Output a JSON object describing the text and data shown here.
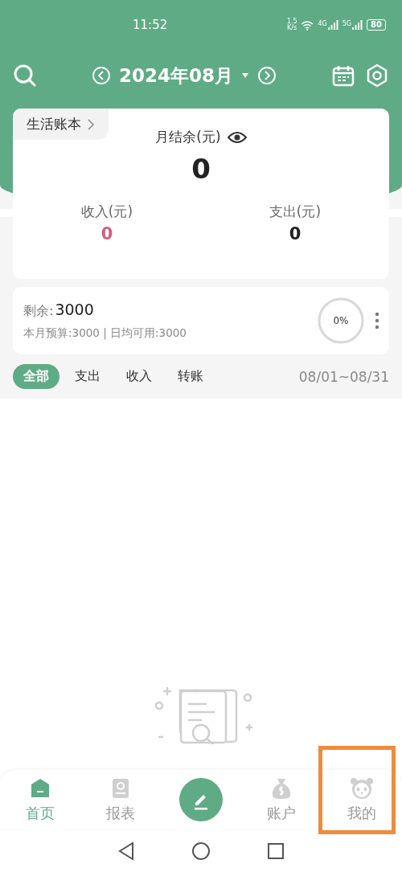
{
  "status_bar": {
    "time": "11:52",
    "speed_value": "1.5",
    "speed_unit": "K/s",
    "networks": [
      "4G",
      "5G"
    ],
    "battery": "80"
  },
  "header": {
    "month": "2024年08月"
  },
  "summary": {
    "book": "生活账本",
    "balance_label": "月结余(元)",
    "balance": "0",
    "income_label": "收入(元)",
    "income": "0",
    "expense_label": "支出(元)",
    "expense": "0"
  },
  "budget": {
    "remaining_label": "剩余:",
    "remaining": "3000",
    "detail": "本月预算:3000 | 日均可用:3000",
    "percent": "0%",
    "level": 0
  },
  "filters": [
    {
      "label": "全部",
      "selected": true
    },
    {
      "label": "支出",
      "selected": false
    },
    {
      "label": "收入",
      "selected": false
    },
    {
      "label": "转账",
      "selected": false
    }
  ],
  "date_range": "08/01~08/31",
  "nav": [
    {
      "kind": "home",
      "label": "首页",
      "selected": true,
      "highlighted": false
    },
    {
      "kind": "report",
      "label": "报表",
      "selected": false,
      "highlighted": false
    },
    {
      "kind": "compose",
      "selected": false,
      "highlighted": false
    },
    {
      "kind": "account",
      "label": "账户",
      "selected": false,
      "highlighted": false
    },
    {
      "kind": "profile",
      "label": "我的",
      "selected": false,
      "highlighted": true
    }
  ]
}
